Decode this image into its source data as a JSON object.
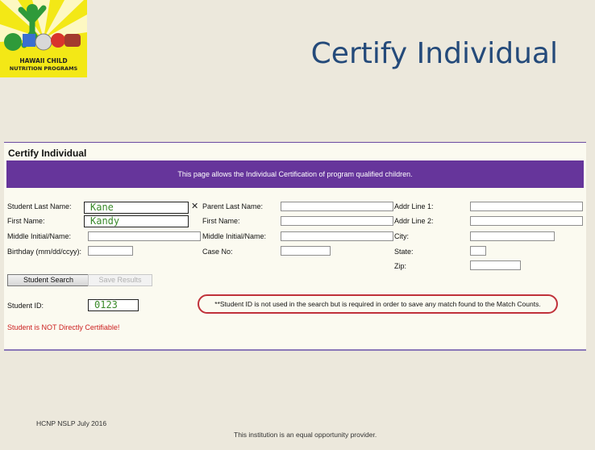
{
  "logo": {
    "line1": "HAWAII CHILD",
    "line2": "NUTRITION PROGRAMS"
  },
  "slide_title": "Certify Individual",
  "panel": {
    "title": "Certify Individual",
    "banner": "This page allows the Individual Certification of program qualified children."
  },
  "form": {
    "student_last_name": {
      "label": "Student Last Name:",
      "value": "Kane"
    },
    "first_name": {
      "label": "First Name:",
      "value": "Kandy"
    },
    "middle_initial_name": {
      "label": "Middle Initial/Name:"
    },
    "birthday": {
      "label": "Birthday (mm/dd/ccyy):"
    },
    "parent_last_name": {
      "label": "Parent Last Name:"
    },
    "parent_first_name": {
      "label": "First Name:"
    },
    "parent_middle_initial_name": {
      "label": "Middle Initial/Name:"
    },
    "case_no": {
      "label": "Case No:"
    },
    "addr_line1": {
      "label": "Addr Line 1:"
    },
    "addr_line2": {
      "label": "Addr Line 2:"
    },
    "city": {
      "label": "City:"
    },
    "state": {
      "label": "State:"
    },
    "zip": {
      "label": "Zip:"
    },
    "clear_glyph": "✕",
    "student_id": {
      "label": "Student ID:",
      "value": "0123"
    }
  },
  "buttons": {
    "student_search": "Student Search",
    "save_results": "Save Results"
  },
  "note": "**Student ID is not used in the search but is required in order to save any match found to the Match Counts.",
  "error": "Student is NOT Directly Certifiable!",
  "footer": {
    "left": "HCNP NSLP July 2016",
    "center": "This institution is an equal opportunity provider."
  },
  "colors": {
    "banner": "#66359b",
    "title": "#244a7a",
    "error": "#cc1f1f",
    "highlight": "#c0313a",
    "entered_text": "#3a8a2a"
  }
}
